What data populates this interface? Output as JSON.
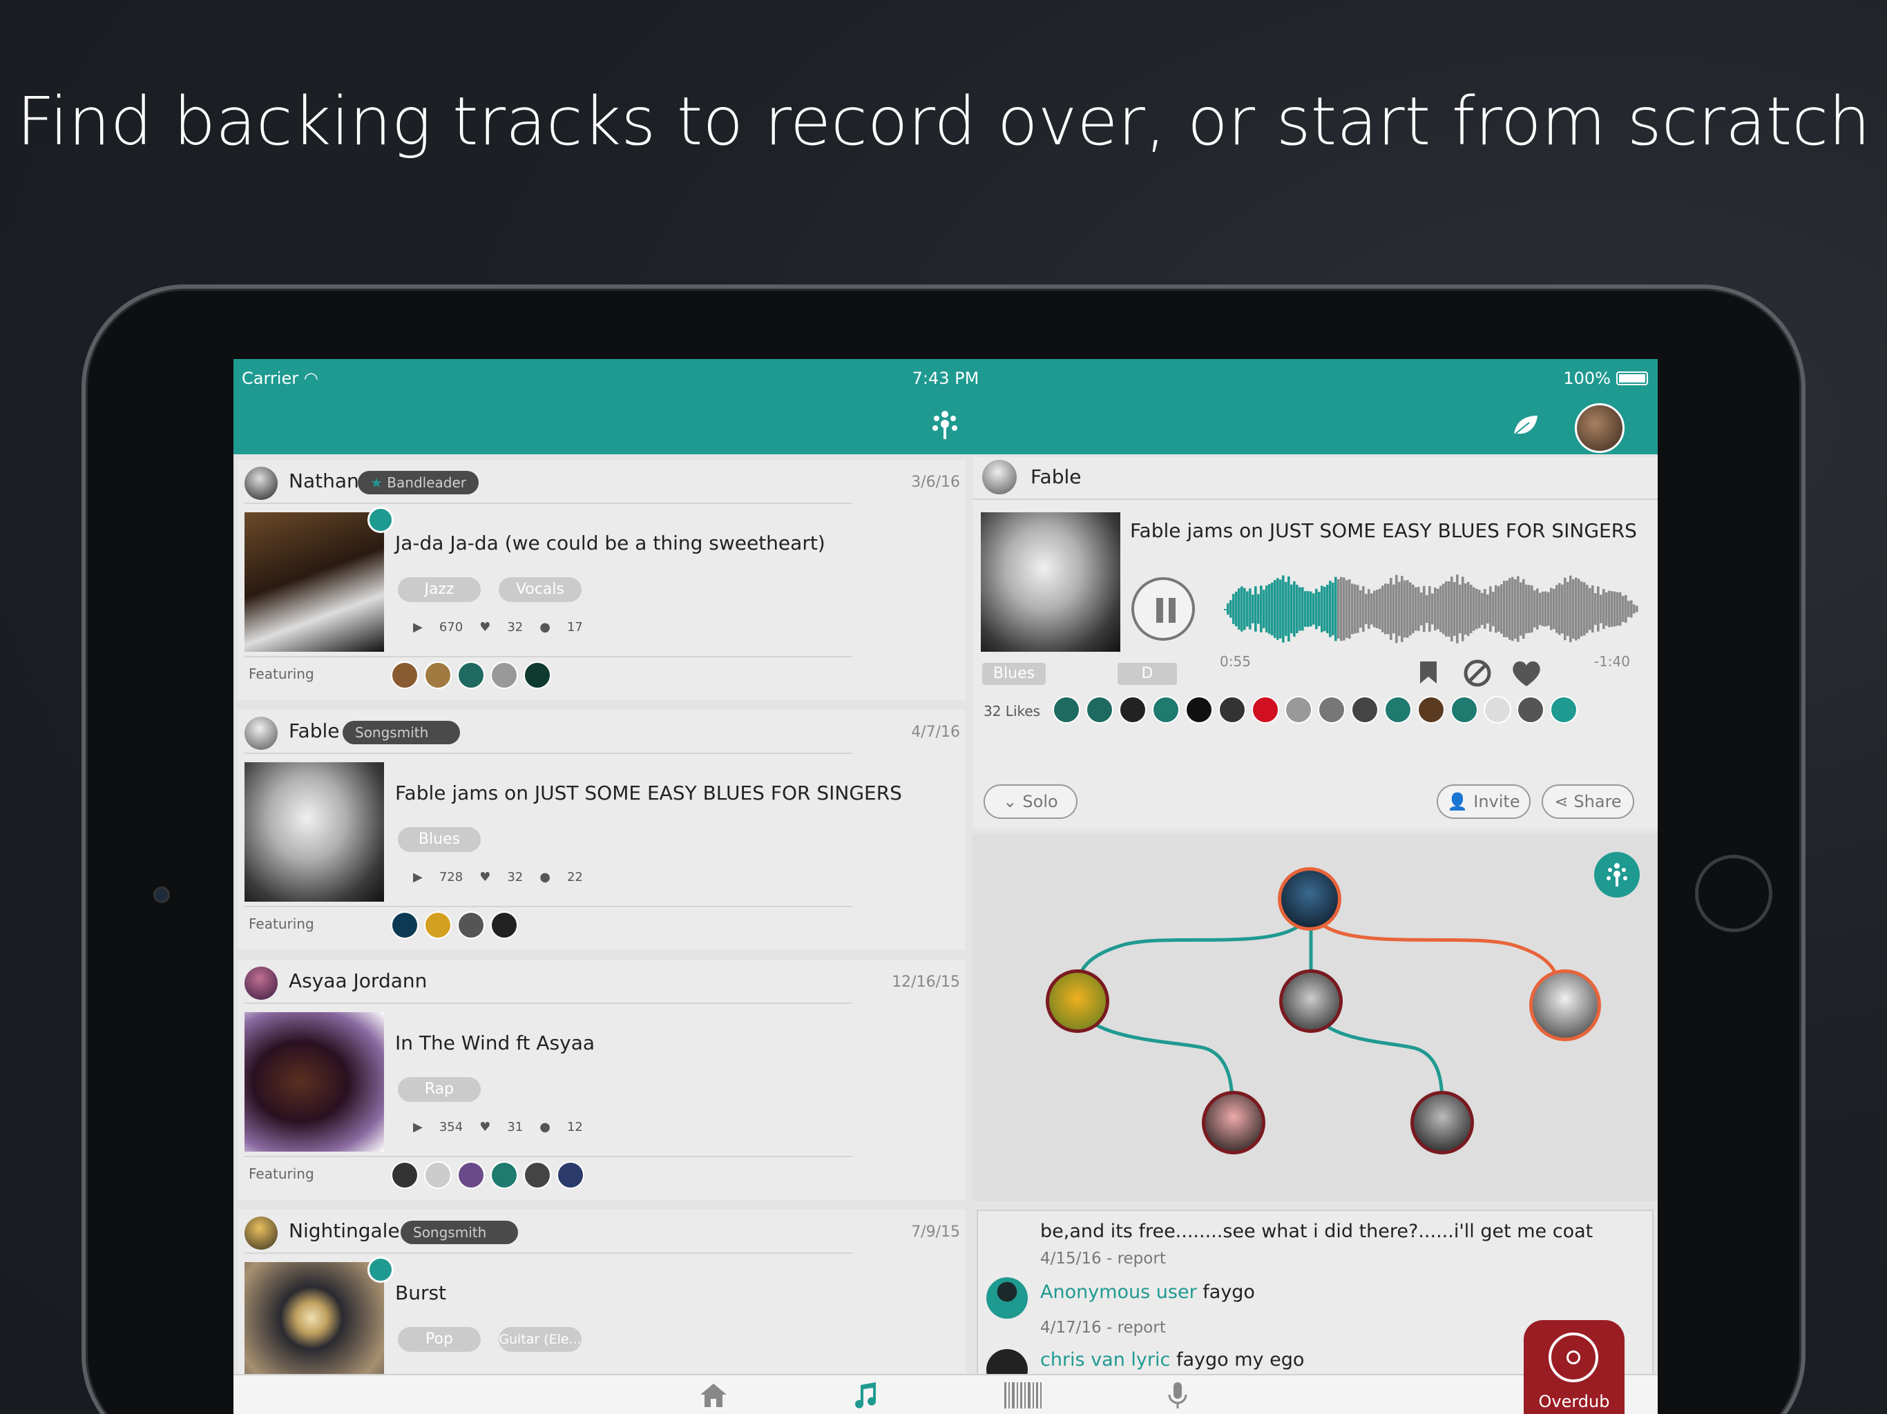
{
  "headline": "Find backing tracks to record over, or start from scratch",
  "status": {
    "carrier": "Carrier",
    "time": "7:43 PM",
    "battery": "100%"
  },
  "feed": [
    {
      "user": "Nathan",
      "role": "Bandleader",
      "date": "3/6/16",
      "title": "Ja-da Ja-da (we could be a thing sweetheart)",
      "tags": [
        "Jazz",
        "Vocals"
      ],
      "plays": "670",
      "likes": "32",
      "comments": "17",
      "featuring_label": "Featuring"
    },
    {
      "user": "Fable",
      "role": "Songsmith",
      "date": "4/7/16",
      "title": "Fable jams on JUST SOME EASY BLUES FOR SINGERS",
      "tags": [
        "Blues"
      ],
      "plays": "728",
      "likes": "32",
      "comments": "22",
      "featuring_label": "Featuring"
    },
    {
      "user": "Asyaa Jordann",
      "role": "",
      "date": "12/16/15",
      "title": "In The Wind ft Asyaa",
      "tags": [
        "Rap"
      ],
      "plays": "354",
      "likes": "31",
      "comments": "12",
      "featuring_label": "Featuring"
    },
    {
      "user": "Nightingale",
      "role": "Songsmith",
      "date": "7/9/15",
      "title": "Burst",
      "tags": [
        "Pop",
        "Guitar (Ele..."
      ]
    }
  ],
  "detail": {
    "user": "Fable",
    "title": "Fable jams on JUST SOME EASY BLUES FOR SINGERS",
    "elapsed": "0:55",
    "remaining": "-1:40",
    "progress": 0.27,
    "genre": "Blues",
    "key": "D",
    "likes": "32 Likes",
    "solo": "Solo",
    "invite": "Invite",
    "share": "Share"
  },
  "comments": [
    {
      "text": "be,and its free........see what i did there?......i'll get me coat",
      "meta": "4/15/16 - report"
    },
    {
      "author": "Anonymous user",
      "text": "faygo"
    },
    {
      "meta": "4/17/16 - report",
      "author": "chris van lyric",
      "text": "faygo my ego"
    }
  ],
  "overdub": "Overdub",
  "colors": {
    "teal": "#1f9a91",
    "orange": "#e8643a",
    "red": "#9b1d24"
  }
}
